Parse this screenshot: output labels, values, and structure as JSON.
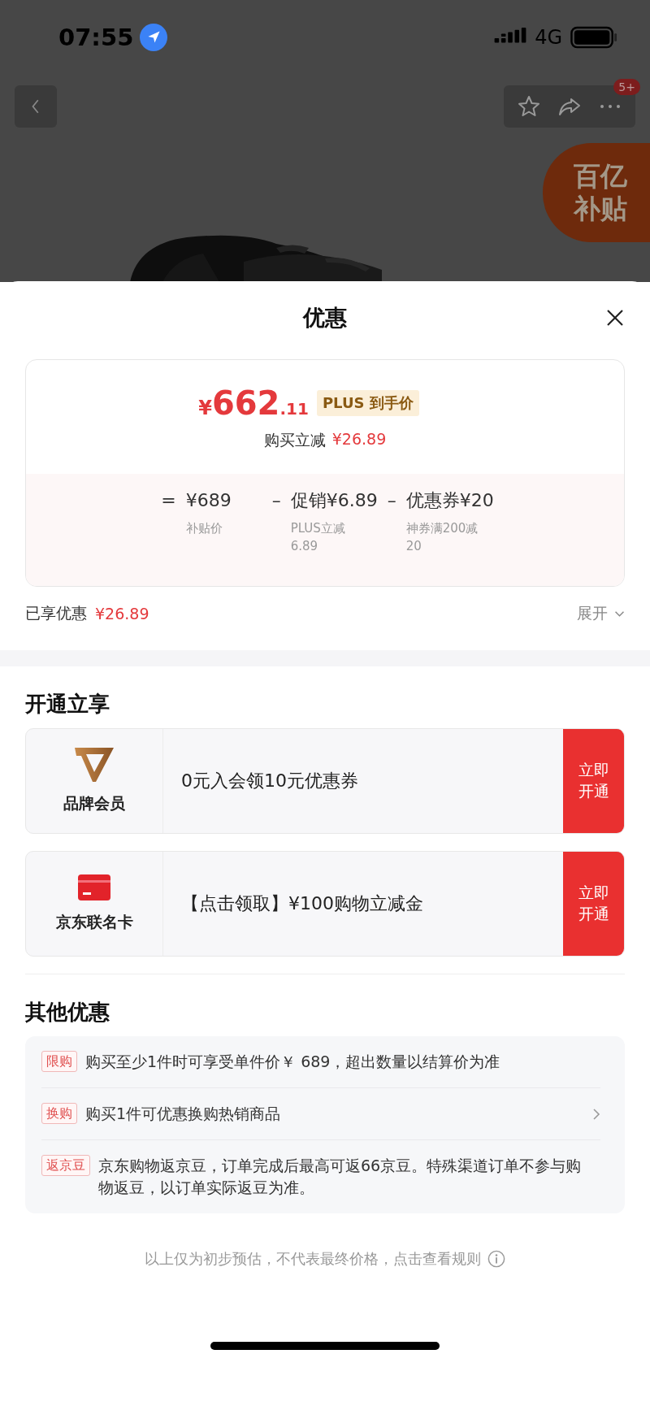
{
  "status_bar": {
    "time": "07:55",
    "network": "4G"
  },
  "nav": {
    "notification_badge": "5+"
  },
  "promo_badge": {
    "line_1": "百亿",
    "line_2": "补贴"
  },
  "sheet": {
    "title": "优惠"
  },
  "price_card": {
    "currency": "¥",
    "price_integer": "662",
    "price_decimal": ".11",
    "price_tag": "PLUS 到手价",
    "reduction_label": "购买立减",
    "reduction_amount": "¥26.89",
    "breakdown": [
      {
        "operator": "=",
        "amount": "¥689",
        "note": "补贴价"
      },
      {
        "operator": "–",
        "amount": "促销¥6.89",
        "note": "PLUS立减6.89"
      },
      {
        "operator": "–",
        "amount": "优惠券¥20",
        "note": "神券满200减20"
      }
    ]
  },
  "savings": {
    "label": "已享优惠",
    "amount": "¥26.89",
    "expand": "展开"
  },
  "memberships": {
    "heading": "开通立享",
    "items": [
      {
        "kind": "brand",
        "label": "品牌会员",
        "offer": "0元入会领10元优惠券",
        "button": "立即开通"
      },
      {
        "kind": "card",
        "label": "京东联名卡",
        "offer": "【点击领取】¥100购物立减金",
        "button": "立即开通"
      }
    ]
  },
  "other_offers": {
    "heading": "其他优惠",
    "items": [
      {
        "tag": "限购",
        "text": "购买至少1件时可享受单件价￥ 689，超出数量以结算价为准",
        "arrow": false
      },
      {
        "tag": "换购",
        "text": "购买1件可优惠换购热销商品",
        "arrow": true
      },
      {
        "tag": "返京豆",
        "text": "京东购物返京豆，订单完成后最高可返66京豆。特殊渠道订单不参与购物返豆，以订单实际返豆为准。",
        "arrow": false
      }
    ]
  },
  "footer": {
    "text": "以上仅为初步预估，不代表最终价格，点击查看规则"
  }
}
